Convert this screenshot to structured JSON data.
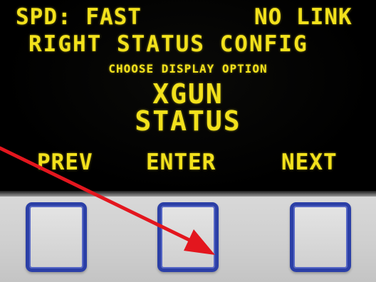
{
  "screen": {
    "speed_status": "SPD: FAST",
    "link_status": "NO LINK",
    "menu_title": "RIGHT STATUS CONFIG",
    "menu_hint": "CHOOSE DISPLAY OPTION",
    "option_line1": "XGUN",
    "option_line2": "STATUS"
  },
  "softkeys": {
    "prev": "PREV",
    "enter": "ENTER",
    "next": "NEXT"
  },
  "colors": {
    "display_text": "#f2e11c",
    "button_border": "#2b3fa6",
    "annotation_arrow": "#e3161e"
  }
}
